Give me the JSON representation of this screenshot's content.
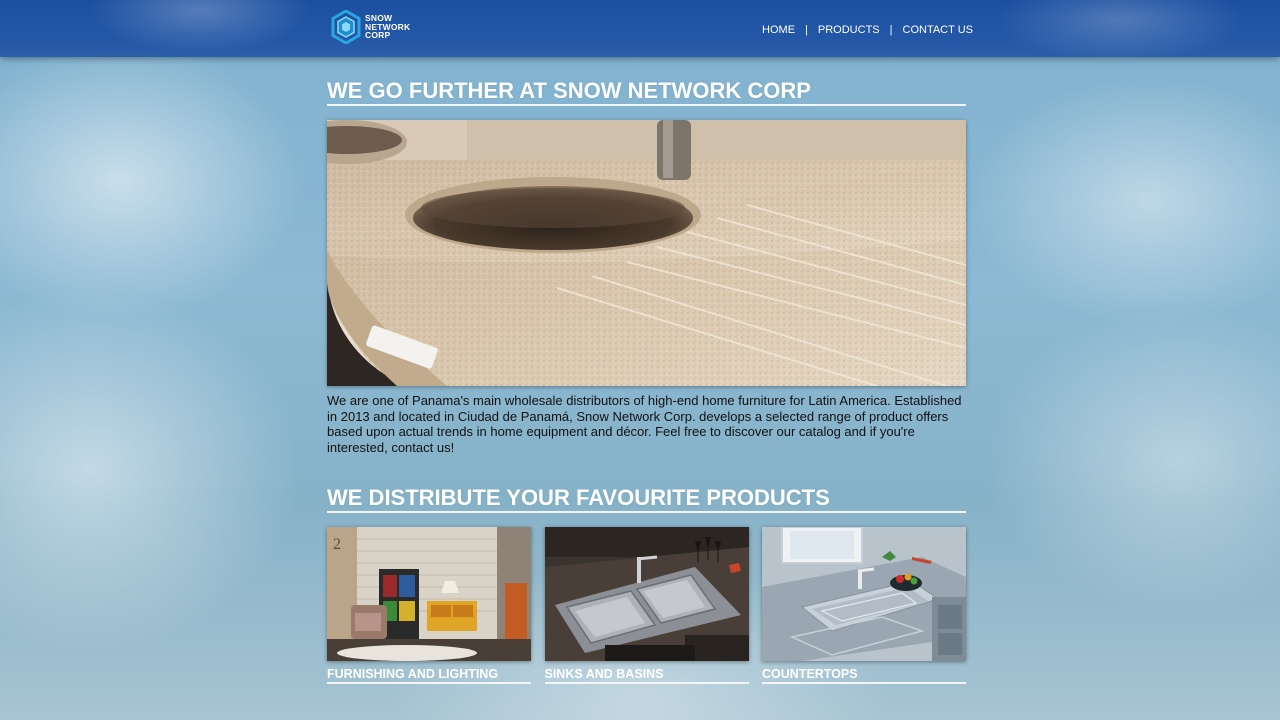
{
  "header": {
    "logo": {
      "line1": "SNOW",
      "line2": "NETWORK",
      "line3": "CORP",
      "icon": "snowflake-hex-icon",
      "colors": {
        "outer": "#2aa7e0",
        "inner": "#8ed8f8"
      }
    },
    "nav": {
      "home": "HOME",
      "products": "PRODUCTS",
      "contact": "CONTACT US",
      "separator": "|"
    },
    "bar_color": "#2256a6"
  },
  "main": {
    "heading": "WE GO FURTHER AT SNOW NETWORK CORP",
    "hero_image": "granite-countertop-with-round-sink",
    "intro": "We are one of Panama's main wholesale distributors of high-end home furniture for Latin America. Established in 2013 and located in Ciudad de Panamá, Snow Network Corp. develops a selected range of product offers based upon actual trends in home equipment and décor. Feel free to discover our catalog and if you're interested, contact us!",
    "products_heading": "WE DISTRIBUTE YOUR FAVOURITE PRODUCTS",
    "products": [
      {
        "label": "FURNISHING AND LIGHTING",
        "image": "furnished-room-with-cabinets"
      },
      {
        "label": "SINKS AND BASINS",
        "image": "stainless-double-sink"
      },
      {
        "label": "COUNTERTOPS",
        "image": "white-countertop-with-sink"
      }
    ]
  }
}
